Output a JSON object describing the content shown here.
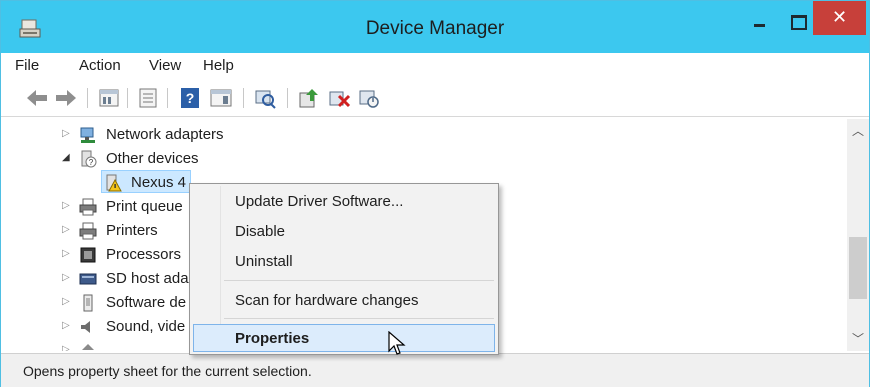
{
  "window": {
    "title": "Device Manager",
    "close_glyph": "✕"
  },
  "menubar": {
    "items": [
      "File",
      "Action",
      "View",
      "Help"
    ]
  },
  "toolbar": {
    "icons": [
      "back-arrow-icon",
      "forward-arrow-icon",
      "properties-view-icon",
      "list-view-icon",
      "help-icon",
      "details-view-icon",
      "scan-hardware-icon",
      "update-driver-icon",
      "uninstall-device-icon",
      "enable-device-icon"
    ]
  },
  "tree": {
    "items": [
      {
        "label": "Network adapters",
        "expanded": false
      },
      {
        "label": "Other devices",
        "expanded": true
      },
      {
        "label": "Nexus 4",
        "child": true,
        "selected": true,
        "warning": true
      },
      {
        "label": "Print queue",
        "expanded": false
      },
      {
        "label": "Printers",
        "expanded": false
      },
      {
        "label": "Processors",
        "expanded": false
      },
      {
        "label": "SD host ada",
        "expanded": false
      },
      {
        "label": "Software de",
        "expanded": false
      },
      {
        "label": "Sound, vide",
        "expanded": false
      }
    ]
  },
  "context_menu": {
    "items": [
      "Update Driver Software...",
      "Disable",
      "Uninstall",
      "Scan for hardware changes",
      "Properties"
    ],
    "highlighted": "Properties"
  },
  "statusbar": {
    "text": "Opens property sheet for the current selection."
  },
  "colors": {
    "titlebar": "#3cc8ef",
    "close": "#c7403a",
    "selection": "#cce8ff",
    "menu_highlight": "#dcecfc"
  }
}
